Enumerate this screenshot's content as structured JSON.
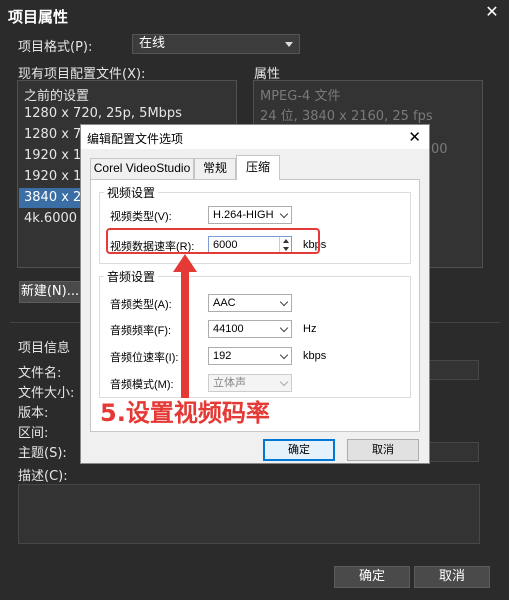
{
  "outer": {
    "title": "项目属性",
    "format_label": "项目格式(P):",
    "format_value": "在线",
    "profiles_label": "现有项目配置文件(X):",
    "profiles": [
      "之前的设置",
      "1280 x 720, 25p, 5Mbps",
      "1280 x 72",
      "1920 x 10",
      "1920 x 10",
      "3840 x 2",
      "4k.6000"
    ],
    "selected_profile_index": 5,
    "props_label": "属性",
    "props_lines": [
      "MPEG-4 文件",
      "24 位, 3840 x 2160, 25 fps",
      "00"
    ],
    "new_button": "新建(N)...",
    "info_label": "项目信息",
    "info_fields": [
      "文件名:",
      "文件大小:",
      "版本:",
      "区间:",
      "主题(S):"
    ],
    "desc_label": "描述(C):",
    "ok": "确定",
    "cancel": "取消"
  },
  "dialog": {
    "title": "编辑配置文件选项",
    "tabs": [
      "Corel VideoStudio",
      "常规",
      "压缩"
    ],
    "active_tab": 2,
    "video_group": "视频设置",
    "video_type_label": "视频类型(V):",
    "video_type_value": "H.264-HIGH",
    "bitrate_label": "视频数据速率(R):",
    "bitrate_value": "6000",
    "bitrate_unit": "kbps",
    "audio_group": "音频设置",
    "audio_type_label": "音频类型(A):",
    "audio_type_value": "AAC",
    "audio_freq_label": "音频频率(F):",
    "audio_freq_value": "44100",
    "audio_freq_unit": "Hz",
    "audio_bitrate_label": "音频位速率(I):",
    "audio_bitrate_value": "192",
    "audio_bitrate_unit": "kbps",
    "audio_mode_label": "音频模式(M):",
    "audio_mode_value": "立体声",
    "ok": "确定",
    "cancel": "取消"
  },
  "annotation": {
    "text": "5.设置视频码率",
    "color": "#e53935"
  },
  "colors": {
    "selection": "#3a6ea5",
    "dark_bg": "#2b2b2b"
  }
}
